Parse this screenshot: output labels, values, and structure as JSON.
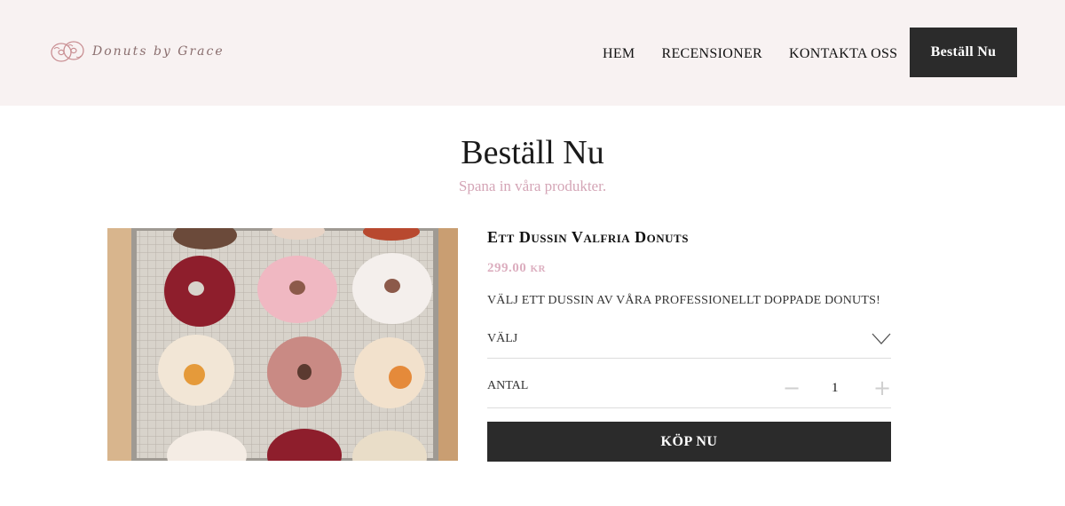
{
  "header": {
    "brand_name": "Donuts by Grace",
    "logo_icon": "donut-logo-icon",
    "nav": [
      {
        "label": "HEM"
      },
      {
        "label": "RECENSIONER"
      },
      {
        "label": "KONTAKTA OSS"
      }
    ],
    "order_button": "Beställ Nu",
    "background": "#f8f2f2"
  },
  "hero": {
    "title": "Beställ Nu",
    "subtitle": "Spana in våra produkter.",
    "subtitle_color": "#d4a5b6"
  },
  "product": {
    "title": "Ett Dussin Valfria Donuts",
    "price": "299.00 kr",
    "description": "VÄLJ ETT DUSSIN AV VÅRA PROFESSIONELLT DOPPADE DONUTS!",
    "select": {
      "label": "VÄLJ",
      "icon": "chevron-down-icon"
    },
    "quantity": {
      "label": "ANTAL",
      "value": "1",
      "minus": "−",
      "plus": "+"
    },
    "buy_button": "KÖP NU",
    "price_color": "#dcaebf"
  }
}
